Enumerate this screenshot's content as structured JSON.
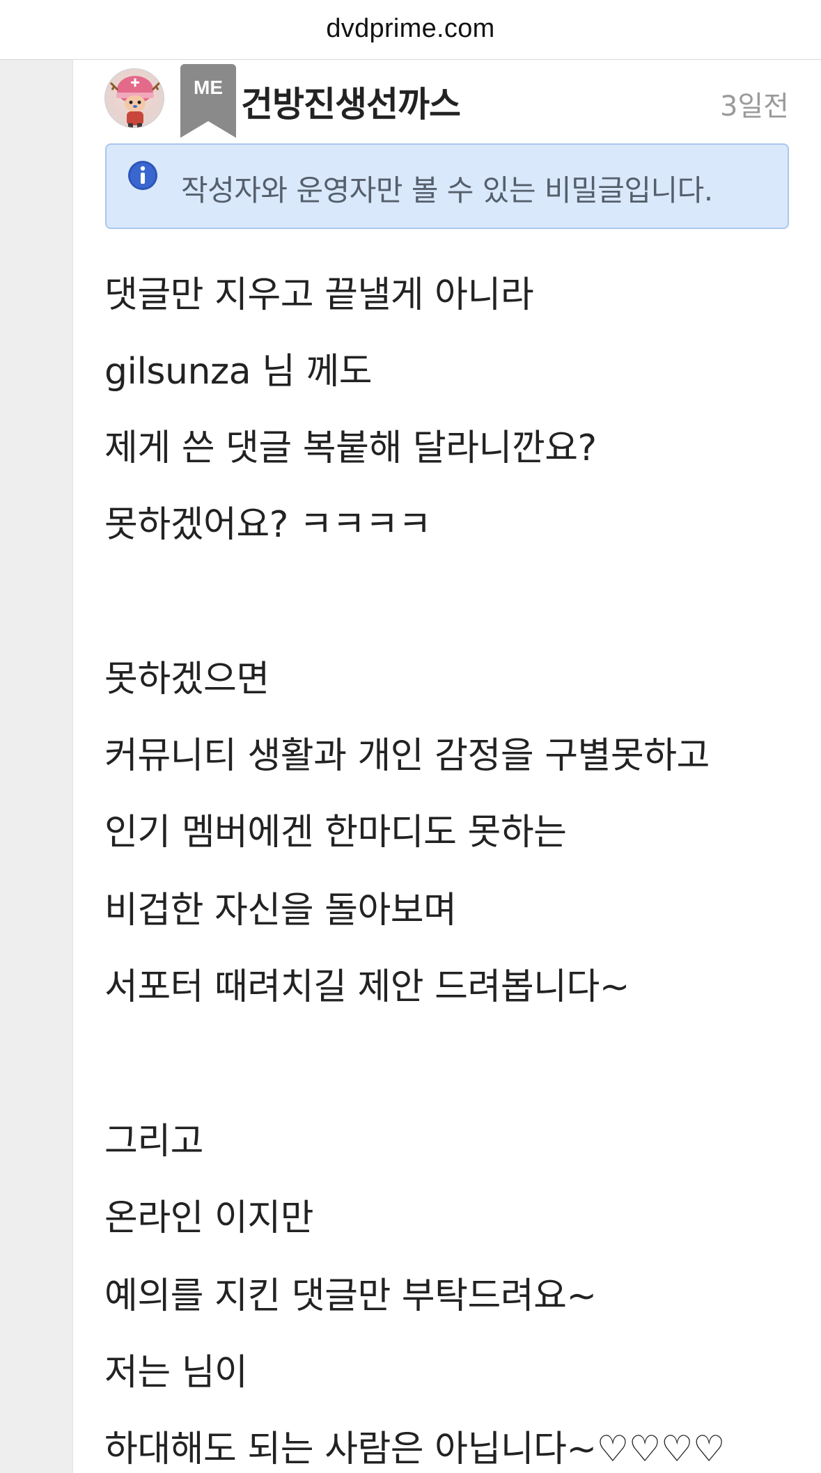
{
  "browser": {
    "url": "dvdprime.com"
  },
  "comment": {
    "author": {
      "name": "건방진생선까스",
      "badge": "ME",
      "avatar_icon": "avatar-character-icon"
    },
    "timestamp": "3일전",
    "notice": {
      "icon": "info-icon",
      "text": "작성자와 운영자만 볼 수 있는 비밀글입니다."
    },
    "lines": [
      "댓글만 지우고 끝낼게 아니라",
      "gilsunza 님 께도",
      "제게 쓴 댓글 복붙해 달라니깐요?",
      "못하겠어요? ㅋㅋㅋㅋ",
      "",
      "못하겠으면",
      "커뮤니티 생활과 개인 감정을 구별못하고",
      "인기 멤버에겐 한마디도 못하는",
      "비겁한 자신을 돌아보며",
      "서포터 때려치길 제안 드려봅니다~",
      "",
      "그리고",
      "온라인 이지만",
      "예의를 지킨 댓글만 부탁드려요~",
      "저는 님이",
      "하대해도 되는 사람은 아닙니다~♡♡♡♡"
    ]
  },
  "colors": {
    "notice_bg": "#d9e8fb",
    "notice_border": "#a9c7ef",
    "info_icon": "#2d55b8",
    "badge_bg": "#8a8a8a",
    "timestamp": "#9a9a9a"
  }
}
